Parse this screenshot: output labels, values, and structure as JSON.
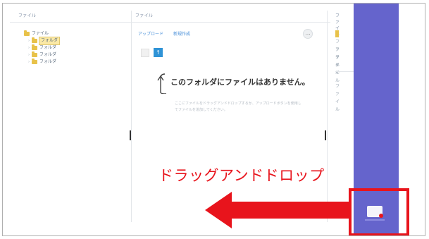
{
  "columns": {
    "tree_header": "ファイル",
    "main_header": "ファイル",
    "right_header": "ファイル"
  },
  "tree": {
    "items": [
      {
        "label": "ファイル",
        "level": 0,
        "expander": ""
      },
      {
        "label": "フォルダ",
        "level": 1,
        "expander": "›",
        "selected": true
      },
      {
        "label": "フォルダ",
        "level": 1,
        "expander": "›"
      },
      {
        "label": "フォルダ",
        "level": 1,
        "expander": "›"
      },
      {
        "label": "フォルダ",
        "level": 1,
        "expander": "›"
      }
    ]
  },
  "main": {
    "link_upload": "アップロード",
    "link_new": "新規作成",
    "more_label": "…",
    "upload_icon": "upload-icon",
    "empty_message": "このフォルダにファイルはありません。",
    "empty_description": "ここにファイルをドラッグアンドドロップするか、アップロードボタンを使用してファイルを追加してください。"
  },
  "right": {
    "lines": [
      "ファイル",
      "ファイル",
      "ファイル",
      "ファイル"
    ]
  },
  "annotation": {
    "label": "ドラッグアンドドロップ",
    "color": "#e8141c"
  },
  "panel": {
    "color": "#6564cc",
    "drop_icon": "file-drop-icon"
  }
}
